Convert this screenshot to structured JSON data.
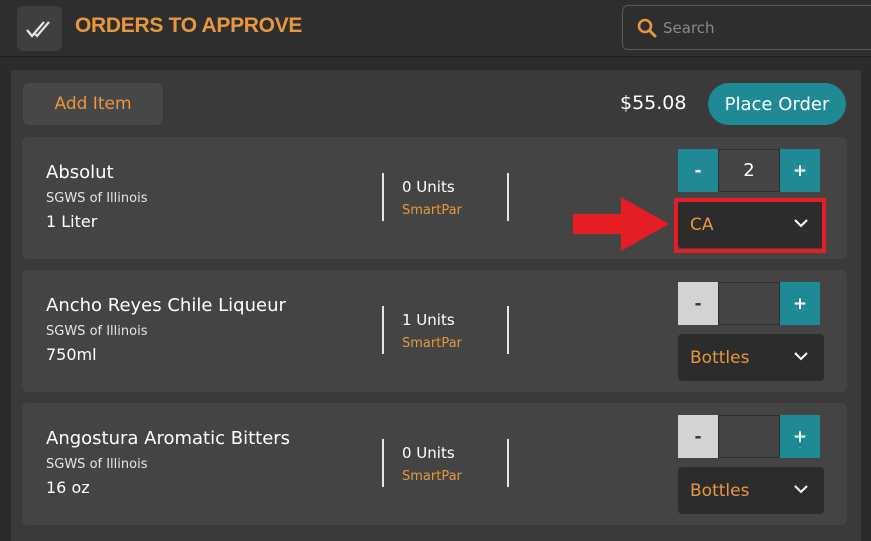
{
  "header": {
    "title": "ORDERS TO APPROVE",
    "search_placeholder": "Search"
  },
  "toolbar": {
    "add_item_label": "Add Item",
    "total": "$55.08",
    "place_order_label": "Place Order"
  },
  "items": [
    {
      "name": "Absolut",
      "supplier": "SGWS of Illinois",
      "size": "1 Liter",
      "units": "0 Units",
      "smartpar": "SmartPar",
      "quantity": "2",
      "unit_type": "CA"
    },
    {
      "name": "Ancho Reyes Chile Liqueur",
      "supplier": "SGWS of Illinois",
      "size": "750ml",
      "units": "1 Units",
      "smartpar": "SmartPar",
      "quantity": "",
      "unit_type": "Bottles"
    },
    {
      "name": "Angostura Aromatic Bitters",
      "supplier": "SGWS of Illinois",
      "size": "16 oz",
      "units": "0 Units",
      "smartpar": "SmartPar",
      "quantity": "",
      "unit_type": "Bottles"
    }
  ],
  "labels": {
    "minus": "-",
    "plus": "+"
  },
  "colors": {
    "accent_orange": "#e8983c",
    "teal": "#1f8a96",
    "highlight_red": "#e31e24"
  },
  "icons": {
    "logo": "double-check-icon",
    "search": "search-icon",
    "dropdown": "chevron-down-icon",
    "annotation": "red-arrow-icon"
  }
}
